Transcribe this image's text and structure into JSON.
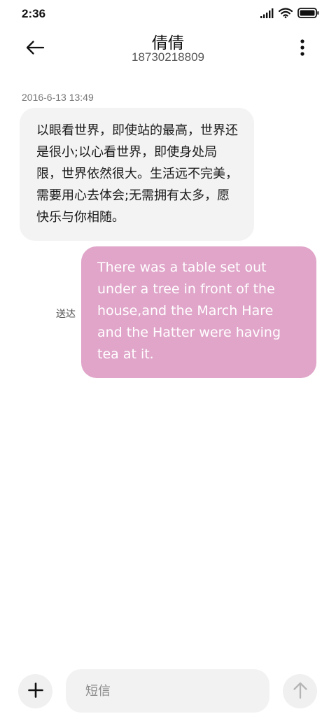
{
  "status_bar": {
    "time": "2:36",
    "icons": [
      "signal-icon",
      "wifi-icon",
      "battery-icon"
    ]
  },
  "header": {
    "back_icon": "arrow-left-icon",
    "contact_name": "倩倩",
    "phone_number": "18730218809",
    "more_icon": "more-vertical-icon"
  },
  "conversation": {
    "timestamp": "2016-6-13 13:49",
    "incoming_message": "以眼看世界，即使站的最高，世界还是很小;以心看世界，即使身处局限，世界依然很大。生活远不完美，需要用心去体会;无需拥有太多，愿快乐与你相随。",
    "outgoing_message": "There was a table set out under a tree in front of the house,and the March Hare and the Hatter were having tea at it.",
    "outgoing_status": "送达"
  },
  "composer": {
    "add_icon": "plus-icon",
    "placeholder": "短信",
    "send_icon": "arrow-up-icon"
  },
  "colors": {
    "outgoing_bubble": "#e0a5c9",
    "incoming_bubble": "#f3f3f3",
    "background": "#ffffff"
  }
}
